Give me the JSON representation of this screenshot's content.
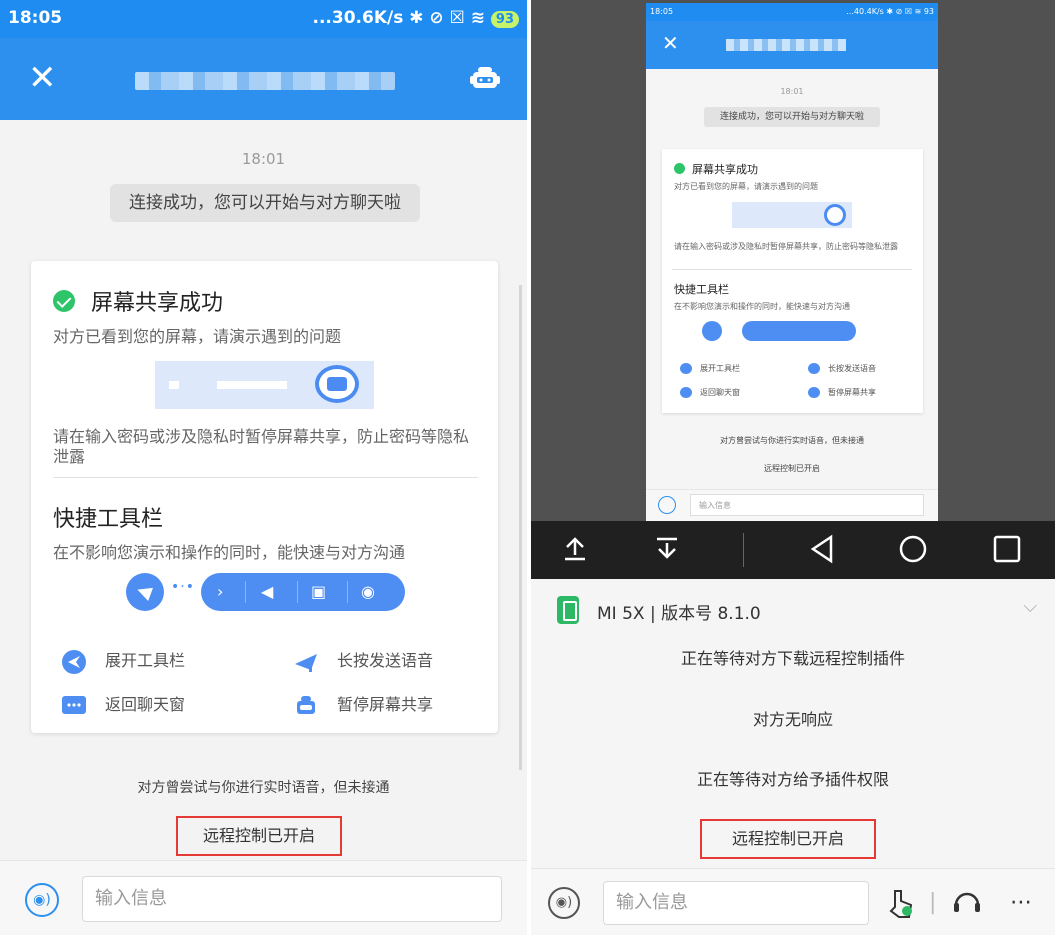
{
  "left": {
    "status": {
      "time": "18:05",
      "right": "...30.6K/s ✱ ⊘ ☒ ≋ ",
      "battery": "93"
    },
    "appbar": {
      "close_icon": "close-icon",
      "bot_icon": "robot-icon"
    },
    "chat": {
      "timestamp": "18:01",
      "system_message": "连接成功，您可以开始与对方聊天啦",
      "card": {
        "title": "屏幕共享成功",
        "subtitle": "对方已看到您的屏幕，请演示遇到的问题",
        "warning": "请在输入密码或涉及隐私时暂停屏幕共享，防止密码等隐私泄露",
        "toolbar_title": "快捷工具栏",
        "toolbar_subtitle": "在不影响您演示和操作的同时，能快速与对方沟通",
        "legend": [
          {
            "icon": "expand-toolbar-icon",
            "label": "展开工具栏"
          },
          {
            "icon": "send-voice-icon",
            "label": "长按发送语音"
          },
          {
            "icon": "chat-icon",
            "label": "返回聊天窗"
          },
          {
            "icon": "pause-share-icon",
            "label": "暂停屏幕共享"
          }
        ]
      },
      "status_call": "对方曾尝试与你进行实时语音，但未接通",
      "status_remote": "远程控制已开启"
    },
    "input": {
      "placeholder": "输入信息",
      "voice_icon": "voice-icon"
    }
  },
  "right": {
    "mini": {
      "status_time": "18:05",
      "status_right": "...40.4K/s ✱ ⊘ ☒ ≋ 93",
      "timestamp": "18:01",
      "system_message": "连接成功，您可以开始与对方聊天啦",
      "card_title": "屏幕共享成功",
      "card_sub": "对方已看到您的屏幕，请演示遇到的问题",
      "card_warn": "请在输入密码或涉及隐私时暂停屏幕共享，防止密码等隐私泄露",
      "toolbar_title": "快捷工具栏",
      "toolbar_sub": "在不影响您演示和操作的同时，能快速与对方沟通",
      "legend": [
        "展开工具栏",
        "长按发送语音",
        "返回聊天窗",
        "暂停屏幕共享"
      ],
      "status_call": "对方曾尝试与你进行实时语音，但未接通",
      "status_remote": "远程控制已开启",
      "input_placeholder": "输入信息"
    },
    "navbar": {
      "upload_icon": "upload-icon",
      "download_icon": "download-icon",
      "back_icon": "back-triangle-icon",
      "home_icon": "home-circle-icon",
      "recents_icon": "recents-square-icon"
    },
    "device": {
      "label": "MI 5X | 版本号 8.1.0"
    },
    "statuses": [
      "正在等待对方下载远程控制插件",
      "对方无响应",
      "正在等待对方给予插件权限"
    ],
    "remote_status": "远程控制已开启",
    "input": {
      "placeholder": "输入信息"
    }
  }
}
